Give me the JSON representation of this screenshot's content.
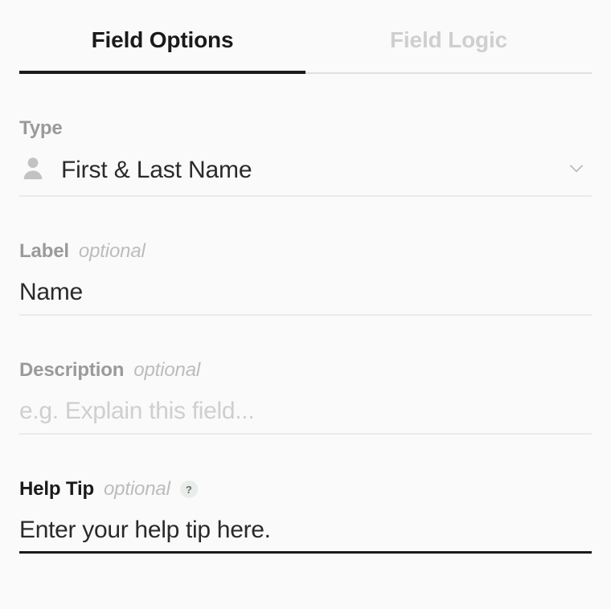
{
  "tabs": {
    "options": "Field Options",
    "logic": "Field Logic"
  },
  "type": {
    "label": "Type",
    "value": "First & Last Name"
  },
  "label_field": {
    "label": "Label",
    "optional": "optional",
    "value": "Name"
  },
  "description_field": {
    "label": "Description",
    "optional": "optional",
    "placeholder": "e.g. Explain this field..."
  },
  "help_tip": {
    "label": "Help Tip",
    "optional": "optional",
    "badge": "?",
    "value": "Enter your help tip here."
  }
}
